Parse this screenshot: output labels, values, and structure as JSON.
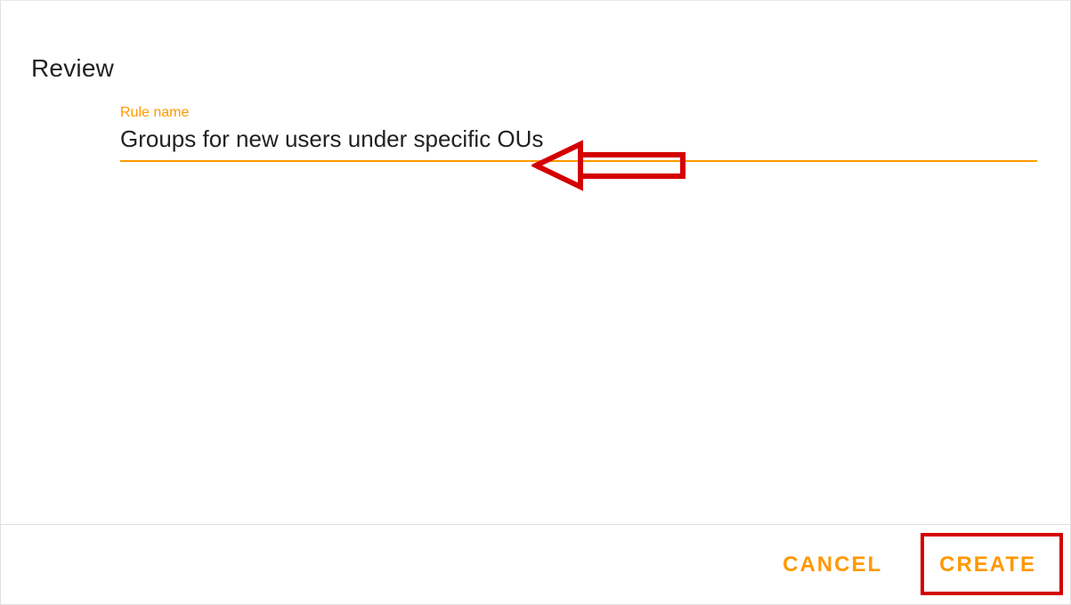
{
  "section": {
    "title": "Review"
  },
  "form": {
    "rule_name_label": "Rule name",
    "rule_name_value": "Groups for new users under specific OUs"
  },
  "buttons": {
    "cancel": "CANCEL",
    "create": "CREATE"
  },
  "annotations": {
    "arrow_points_to": "rule-name-input",
    "rect_highlights": "create-button"
  },
  "colors": {
    "accent": "#ff9800",
    "annotation": "#d40000"
  }
}
